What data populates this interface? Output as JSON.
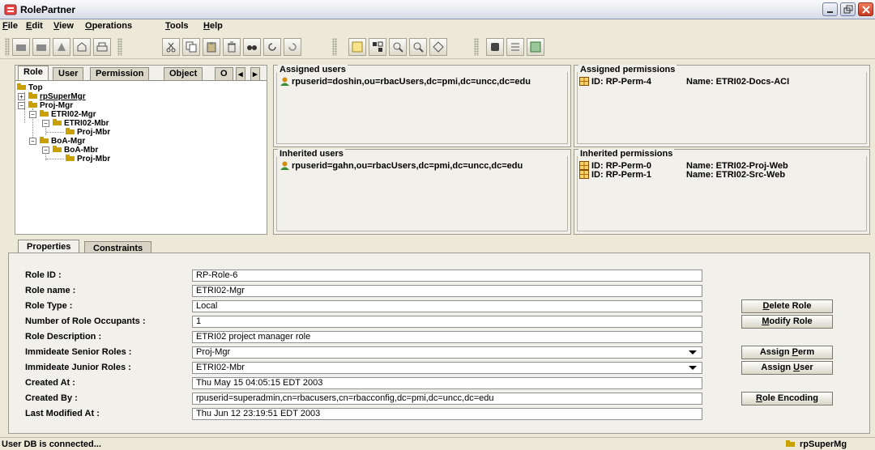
{
  "window": {
    "title": "RolePartner"
  },
  "menu": [
    {
      "key": "F",
      "rest": "ile"
    },
    {
      "key": "E",
      "rest": "dit"
    },
    {
      "key": "V",
      "rest": "iew"
    },
    {
      "key": "O",
      "rest": "perations"
    },
    {
      "key": "T",
      "rest": "ools"
    },
    {
      "key": "H",
      "rest": "elp"
    }
  ],
  "toolbar_icons": [
    "new-role-icon",
    "new-user-icon",
    "new-permission-icon",
    "new-object-icon",
    "print-icon",
    "cut-icon",
    "copy-icon",
    "paste-icon",
    "delete-icon",
    "find-icon",
    "refresh-icon",
    "undo-icon",
    "tree-view-icon",
    "graph-view-icon",
    "zoom-in-icon",
    "zoom-out-icon",
    "navigate-icon",
    "db-connect-icon",
    "list-icon",
    "export-icon"
  ],
  "nav": {
    "tabs": [
      "Role",
      "User",
      "Permission",
      "Object",
      "O"
    ],
    "tree": [
      {
        "label": "Top",
        "depth": 0
      },
      {
        "label": "rpSuperMgr",
        "depth": 0
      },
      {
        "label": "Proj-Mgr",
        "depth": 0
      },
      {
        "label": "ETRI02-Mgr",
        "depth": 1
      },
      {
        "label": "ETRI02-Mbr",
        "depth": 2
      },
      {
        "label": "Proj-Mbr",
        "depth": 3
      },
      {
        "label": "BoA-Mgr",
        "depth": 1
      },
      {
        "label": "BoA-Mbr",
        "depth": 2
      },
      {
        "label": "Proj-Mbr",
        "depth": 3
      }
    ]
  },
  "assigned_users": {
    "title": "Assigned users",
    "items": [
      "rpuserid=doshin,ou=rbacUsers,dc=pmi,dc=uncc,dc=edu"
    ]
  },
  "inherited_users": {
    "title": "Inherited users",
    "items": [
      "rpuserid=gahn,ou=rbacUsers,dc=pmi,dc=uncc,dc=edu"
    ]
  },
  "assigned_permissions": {
    "title": "Assigned permissions",
    "items": [
      {
        "id": "ID: RP-Perm-4",
        "name": "Name: ETRI02-Docs-ACI"
      }
    ]
  },
  "inherited_permissions": {
    "title": "Inherited permissions",
    "items": [
      {
        "id": "ID: RP-Perm-0",
        "name": "Name: ETRI02-Proj-Web"
      },
      {
        "id": "ID: RP-Perm-1",
        "name": "Name: ETRI02-Src-Web"
      }
    ]
  },
  "props": {
    "tabs": [
      "Properties",
      "Constraints"
    ],
    "fields": [
      {
        "label": "Role ID :",
        "value": "RP-Role-6",
        "type": "text"
      },
      {
        "label": "Role name :",
        "value": "ETRI02-Mgr",
        "type": "text"
      },
      {
        "label": "Role Type :",
        "value": "Local",
        "type": "text"
      },
      {
        "label": "Number of Role Occupants :",
        "value": "1",
        "type": "text"
      },
      {
        "label": "Role Description :",
        "value": "ETRI02 project manager role",
        "type": "text"
      },
      {
        "label": "Immideate Senior Roles :",
        "value": "Proj-Mgr",
        "type": "combo"
      },
      {
        "label": "Immideate Junior Roles :",
        "value": "ETRI02-Mbr",
        "type": "combo"
      },
      {
        "label": "Created At :",
        "value": "Thu May 15 04:05:15 EDT 2003",
        "type": "text"
      },
      {
        "label": "Created By :",
        "value": "rpuserid=superadmin,cn=rbacusers,cn=rbacconfig,dc=pmi,dc=uncc,dc=edu",
        "type": "text"
      },
      {
        "label": "Last Modified At :",
        "value": "Thu Jun 12 23:19:51 EDT 2003",
        "type": "text"
      }
    ],
    "buttons": {
      "delete": {
        "pre": "",
        "key": "D",
        "post": "elete Role"
      },
      "modify": {
        "pre": "",
        "key": "M",
        "post": "odify Role"
      },
      "assign_perm": {
        "pre": "Assign ",
        "key": "P",
        "post": "erm"
      },
      "assign_user": {
        "pre": "Assign ",
        "key": "U",
        "post": "ser"
      },
      "encoding": {
        "pre": "",
        "key": "R",
        "post": "ole Encoding"
      }
    }
  },
  "status": {
    "message": "User DB is connected...",
    "user": "rpSuperMg"
  },
  "colors": {
    "role_icon": "#c8a000",
    "user_icon": "#d58a00",
    "perm_icon": "#b06a00"
  }
}
